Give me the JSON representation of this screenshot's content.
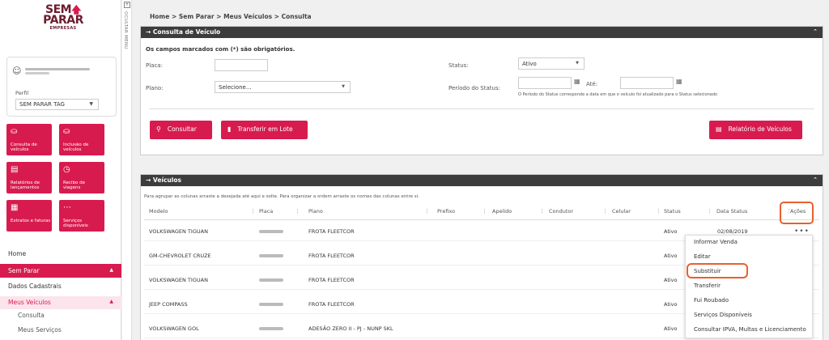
{
  "logo": {
    "line1": "SEM",
    "line2": "PARAR",
    "line3": "EMPRESAS"
  },
  "profile": {
    "perfil_label": "Perfil",
    "perfil_value": "SEM PARAR TAG"
  },
  "tiles": [
    {
      "label": "Consulta de veículos",
      "icon": "car-search-icon"
    },
    {
      "label": "Inclusão de veículos",
      "icon": "car-add-icon"
    },
    {
      "label": "Relatórios de lançamentos",
      "icon": "report-icon"
    },
    {
      "label": "Recibo de viagens",
      "icon": "receipt-icon"
    },
    {
      "label": "Extratos e faturas",
      "icon": "statement-icon"
    },
    {
      "label": "Serviços disponíveis",
      "icon": "services-icon"
    }
  ],
  "menu": {
    "home": "Home",
    "sem_parar": "Sem Parar",
    "dados": "Dados Cadastrais",
    "meus_veiculos": "Meus Veículos",
    "consulta": "Consulta",
    "meus_servicos": "Meus Serviços"
  },
  "hide_menu": "OCULTAR MENU",
  "breadcrumb": "Home > Sem Parar > Meus Veículos > Consulta",
  "consulta_panel": {
    "title": "Consulta de Veículo",
    "required_note": "Os campos marcados com (*) são obrigatórios.",
    "placa_label": "Placa:",
    "placa_value": "",
    "plano_label": "Plano:",
    "plano_value": "Selecione...",
    "status_label": "Status:",
    "status_value": "Ativo",
    "periodo_label": "Período do Status:",
    "ate_label": "Até:",
    "periodo_note": "O Período do Status corresponde a data em que o veículo foi atualizado para o Status selecionado",
    "btn_consultar": "Consultar",
    "btn_lote": "Transferir em Lote",
    "btn_relatorio": "Relatório de Veículos"
  },
  "veiculos_panel": {
    "title": "Veículos",
    "hint": "Para agrupar as colunas arraste a desejada até aqui e solte. Para organizar a ordem arraste os nomes das colunas entre si.",
    "columns": [
      "Modelo",
      "Placa",
      "Plano",
      "Prefixo",
      "Apelido",
      "Condutor",
      "Celular",
      "Status",
      "Data Status",
      "Ações"
    ],
    "rows": [
      {
        "modelo": "VOLKSWAGEN TIGUAN",
        "plano": "FROTA FLEETCOR",
        "status": "Ativo",
        "data_status": "02/08/2019"
      },
      {
        "modelo": "GM-CHEVROLET CRUZE",
        "plano": "FROTA FLEETCOR",
        "status": "Ativo",
        "data_status": ""
      },
      {
        "modelo": "VOLKSWAGEN TIGUAN",
        "plano": "FROTA FLEETCOR",
        "status": "Ativo",
        "data_status": ""
      },
      {
        "modelo": "JEEP COMPASS",
        "plano": "FROTA FLEETCOR",
        "status": "Ativo",
        "data_status": ""
      },
      {
        "modelo": "VOLKSWAGEN GOL",
        "plano": "ADESÃO ZERO II - PJ - NUNP SKL",
        "status": "Ativo",
        "data_status": ""
      }
    ]
  },
  "actions_menu": [
    "Informar Venda",
    "Editar",
    "Substituir",
    "Transferir",
    "Fui Roubado",
    "Serviços Disponíveis",
    "Consultar IPVA, Multas e Licenciamento"
  ],
  "colors": {
    "brand": "#d81b4f",
    "dark_header": "#3c3c3c",
    "highlight": "#e8602c"
  }
}
